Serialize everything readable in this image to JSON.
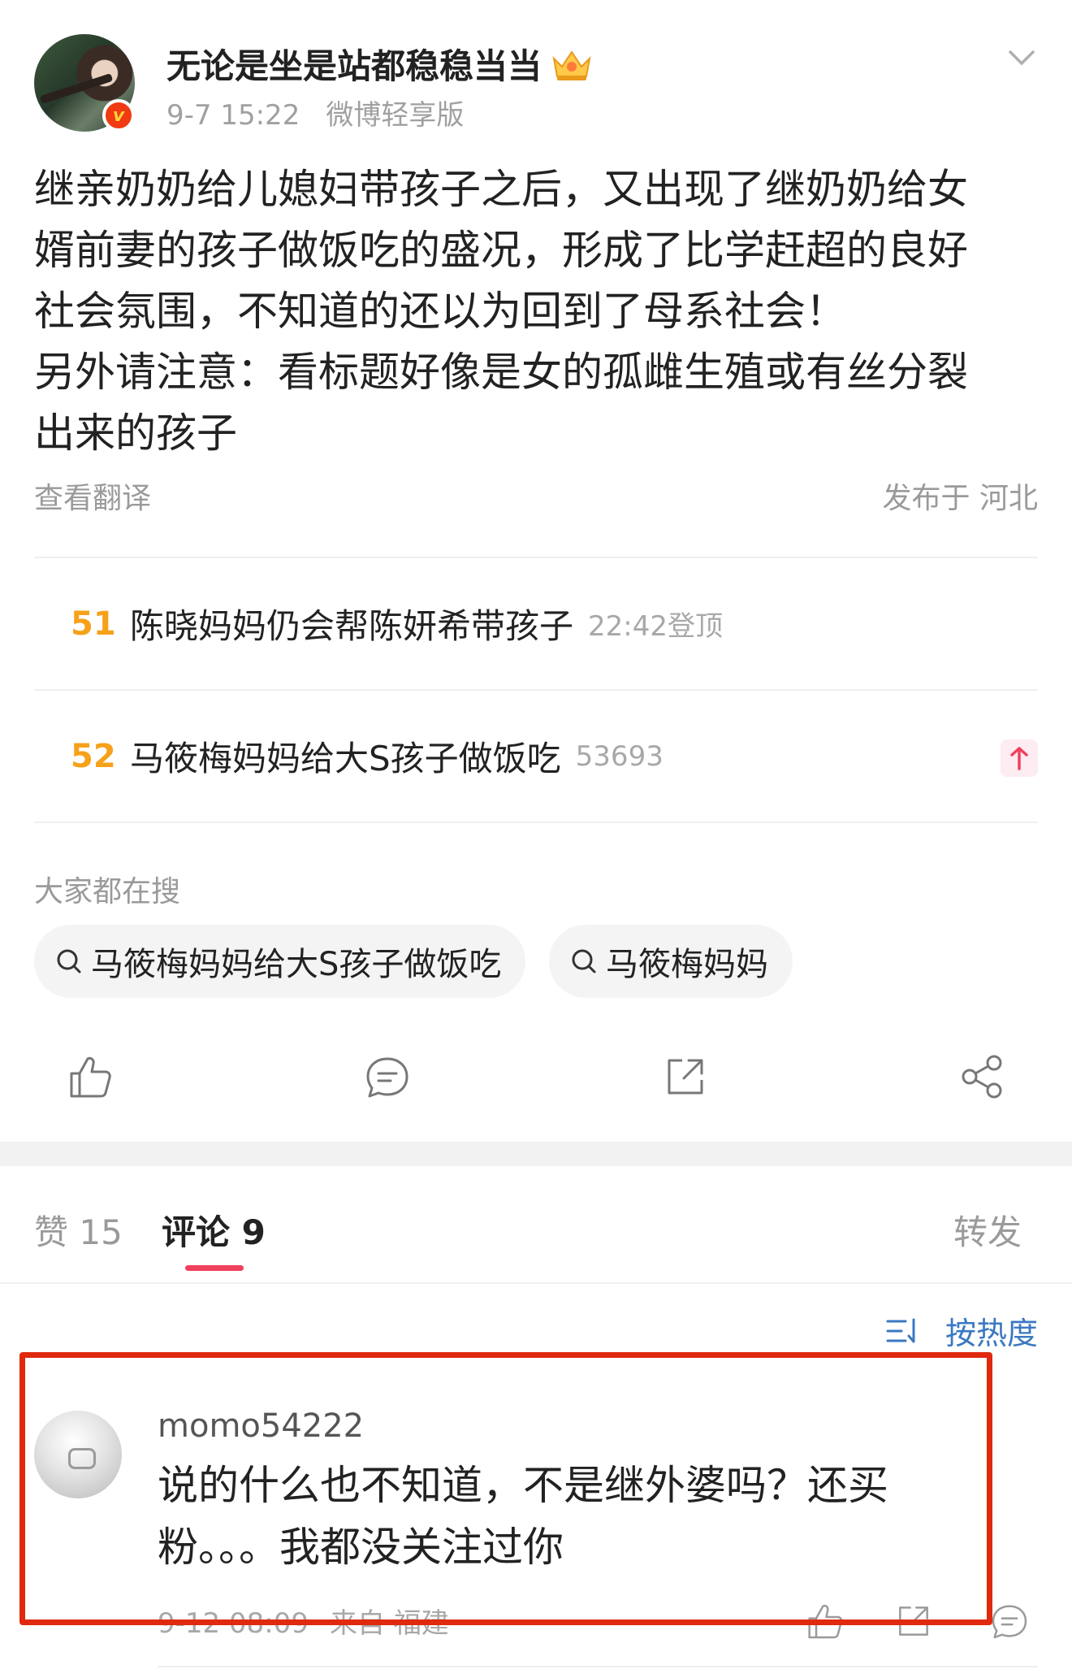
{
  "post": {
    "username": "无论是坐是站都稳稳当当",
    "time": "9-7 15:22",
    "source": "微博轻享版",
    "body_lines": [
      "继亲奶奶给儿媳妇带孩子之后，又出现了继奶奶给女",
      "婿前妻的孩子做饭吃的盛况，形成了比学赶超的良好",
      "社会氛围，不知道的还以为回到了母系社会！",
      "另外请注意：看标题好像是女的孤雌生殖或有丝分裂",
      "出来的孩子"
    ],
    "translate_label": "查看翻译",
    "location": "发布于 河北"
  },
  "hot_list": [
    {
      "rank": "51",
      "title": "陈晓妈妈仍会帮陈妍希带孩子",
      "extra": "22:42登顶"
    },
    {
      "rank": "52",
      "title": "马筱梅妈妈给大S孩子做饭吃",
      "extra": "53693",
      "trend_icon": "arrow-up-icon"
    }
  ],
  "search": {
    "label": "大家都在搜",
    "chips": [
      "马筱梅妈妈给大S孩子做饭吃",
      "马筱梅妈妈"
    ]
  },
  "actions": [
    "like-icon",
    "comment-icon",
    "repost-icon",
    "share-icon"
  ],
  "tabs": {
    "likes": "赞 15",
    "comments": "评论 9",
    "reposts": "转发"
  },
  "sort_label": "按热度",
  "comment": {
    "username": "momo54222",
    "text_lines": [
      "说的什么也不知道，不是继外婆吗？还买",
      "粉。。。我都没关注过你"
    ],
    "time": "9-12 08:09",
    "source": "来自 福建"
  },
  "colors": {
    "accent_red": "#e0290e",
    "rank_orange": "#f6a11a",
    "link_blue": "#3b78c2",
    "tab_underline": "#f0405e"
  }
}
